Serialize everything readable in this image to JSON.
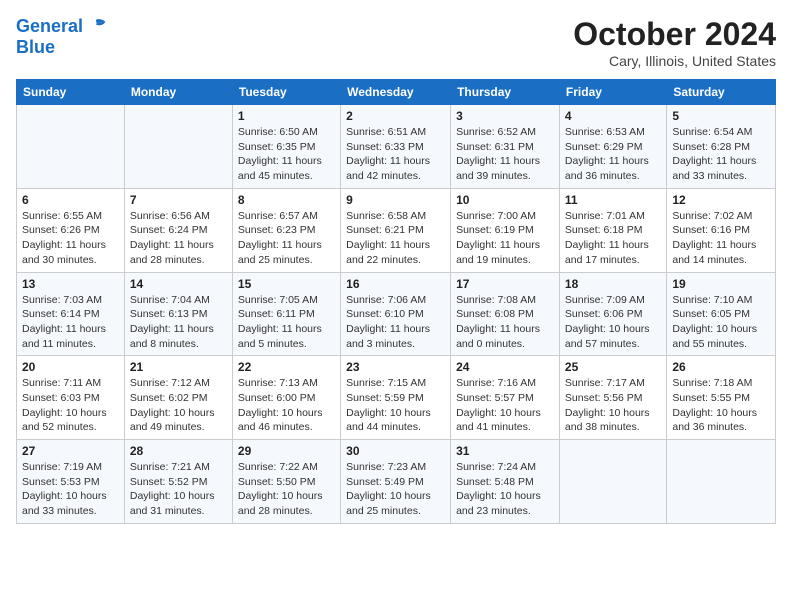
{
  "header": {
    "logo_line1": "General",
    "logo_line2": "Blue",
    "month": "October 2024",
    "location": "Cary, Illinois, United States"
  },
  "days_of_week": [
    "Sunday",
    "Monday",
    "Tuesday",
    "Wednesday",
    "Thursday",
    "Friday",
    "Saturday"
  ],
  "weeks": [
    [
      {
        "num": "",
        "sunrise": "",
        "sunset": "",
        "daylight": ""
      },
      {
        "num": "",
        "sunrise": "",
        "sunset": "",
        "daylight": ""
      },
      {
        "num": "1",
        "sunrise": "Sunrise: 6:50 AM",
        "sunset": "Sunset: 6:35 PM",
        "daylight": "Daylight: 11 hours and 45 minutes."
      },
      {
        "num": "2",
        "sunrise": "Sunrise: 6:51 AM",
        "sunset": "Sunset: 6:33 PM",
        "daylight": "Daylight: 11 hours and 42 minutes."
      },
      {
        "num": "3",
        "sunrise": "Sunrise: 6:52 AM",
        "sunset": "Sunset: 6:31 PM",
        "daylight": "Daylight: 11 hours and 39 minutes."
      },
      {
        "num": "4",
        "sunrise": "Sunrise: 6:53 AM",
        "sunset": "Sunset: 6:29 PM",
        "daylight": "Daylight: 11 hours and 36 minutes."
      },
      {
        "num": "5",
        "sunrise": "Sunrise: 6:54 AM",
        "sunset": "Sunset: 6:28 PM",
        "daylight": "Daylight: 11 hours and 33 minutes."
      }
    ],
    [
      {
        "num": "6",
        "sunrise": "Sunrise: 6:55 AM",
        "sunset": "Sunset: 6:26 PM",
        "daylight": "Daylight: 11 hours and 30 minutes."
      },
      {
        "num": "7",
        "sunrise": "Sunrise: 6:56 AM",
        "sunset": "Sunset: 6:24 PM",
        "daylight": "Daylight: 11 hours and 28 minutes."
      },
      {
        "num": "8",
        "sunrise": "Sunrise: 6:57 AM",
        "sunset": "Sunset: 6:23 PM",
        "daylight": "Daylight: 11 hours and 25 minutes."
      },
      {
        "num": "9",
        "sunrise": "Sunrise: 6:58 AM",
        "sunset": "Sunset: 6:21 PM",
        "daylight": "Daylight: 11 hours and 22 minutes."
      },
      {
        "num": "10",
        "sunrise": "Sunrise: 7:00 AM",
        "sunset": "Sunset: 6:19 PM",
        "daylight": "Daylight: 11 hours and 19 minutes."
      },
      {
        "num": "11",
        "sunrise": "Sunrise: 7:01 AM",
        "sunset": "Sunset: 6:18 PM",
        "daylight": "Daylight: 11 hours and 17 minutes."
      },
      {
        "num": "12",
        "sunrise": "Sunrise: 7:02 AM",
        "sunset": "Sunset: 6:16 PM",
        "daylight": "Daylight: 11 hours and 14 minutes."
      }
    ],
    [
      {
        "num": "13",
        "sunrise": "Sunrise: 7:03 AM",
        "sunset": "Sunset: 6:14 PM",
        "daylight": "Daylight: 11 hours and 11 minutes."
      },
      {
        "num": "14",
        "sunrise": "Sunrise: 7:04 AM",
        "sunset": "Sunset: 6:13 PM",
        "daylight": "Daylight: 11 hours and 8 minutes."
      },
      {
        "num": "15",
        "sunrise": "Sunrise: 7:05 AM",
        "sunset": "Sunset: 6:11 PM",
        "daylight": "Daylight: 11 hours and 5 minutes."
      },
      {
        "num": "16",
        "sunrise": "Sunrise: 7:06 AM",
        "sunset": "Sunset: 6:10 PM",
        "daylight": "Daylight: 11 hours and 3 minutes."
      },
      {
        "num": "17",
        "sunrise": "Sunrise: 7:08 AM",
        "sunset": "Sunset: 6:08 PM",
        "daylight": "Daylight: 11 hours and 0 minutes."
      },
      {
        "num": "18",
        "sunrise": "Sunrise: 7:09 AM",
        "sunset": "Sunset: 6:06 PM",
        "daylight": "Daylight: 10 hours and 57 minutes."
      },
      {
        "num": "19",
        "sunrise": "Sunrise: 7:10 AM",
        "sunset": "Sunset: 6:05 PM",
        "daylight": "Daylight: 10 hours and 55 minutes."
      }
    ],
    [
      {
        "num": "20",
        "sunrise": "Sunrise: 7:11 AM",
        "sunset": "Sunset: 6:03 PM",
        "daylight": "Daylight: 10 hours and 52 minutes."
      },
      {
        "num": "21",
        "sunrise": "Sunrise: 7:12 AM",
        "sunset": "Sunset: 6:02 PM",
        "daylight": "Daylight: 10 hours and 49 minutes."
      },
      {
        "num": "22",
        "sunrise": "Sunrise: 7:13 AM",
        "sunset": "Sunset: 6:00 PM",
        "daylight": "Daylight: 10 hours and 46 minutes."
      },
      {
        "num": "23",
        "sunrise": "Sunrise: 7:15 AM",
        "sunset": "Sunset: 5:59 PM",
        "daylight": "Daylight: 10 hours and 44 minutes."
      },
      {
        "num": "24",
        "sunrise": "Sunrise: 7:16 AM",
        "sunset": "Sunset: 5:57 PM",
        "daylight": "Daylight: 10 hours and 41 minutes."
      },
      {
        "num": "25",
        "sunrise": "Sunrise: 7:17 AM",
        "sunset": "Sunset: 5:56 PM",
        "daylight": "Daylight: 10 hours and 38 minutes."
      },
      {
        "num": "26",
        "sunrise": "Sunrise: 7:18 AM",
        "sunset": "Sunset: 5:55 PM",
        "daylight": "Daylight: 10 hours and 36 minutes."
      }
    ],
    [
      {
        "num": "27",
        "sunrise": "Sunrise: 7:19 AM",
        "sunset": "Sunset: 5:53 PM",
        "daylight": "Daylight: 10 hours and 33 minutes."
      },
      {
        "num": "28",
        "sunrise": "Sunrise: 7:21 AM",
        "sunset": "Sunset: 5:52 PM",
        "daylight": "Daylight: 10 hours and 31 minutes."
      },
      {
        "num": "29",
        "sunrise": "Sunrise: 7:22 AM",
        "sunset": "Sunset: 5:50 PM",
        "daylight": "Daylight: 10 hours and 28 minutes."
      },
      {
        "num": "30",
        "sunrise": "Sunrise: 7:23 AM",
        "sunset": "Sunset: 5:49 PM",
        "daylight": "Daylight: 10 hours and 25 minutes."
      },
      {
        "num": "31",
        "sunrise": "Sunrise: 7:24 AM",
        "sunset": "Sunset: 5:48 PM",
        "daylight": "Daylight: 10 hours and 23 minutes."
      },
      {
        "num": "",
        "sunrise": "",
        "sunset": "",
        "daylight": ""
      },
      {
        "num": "",
        "sunrise": "",
        "sunset": "",
        "daylight": ""
      }
    ]
  ]
}
